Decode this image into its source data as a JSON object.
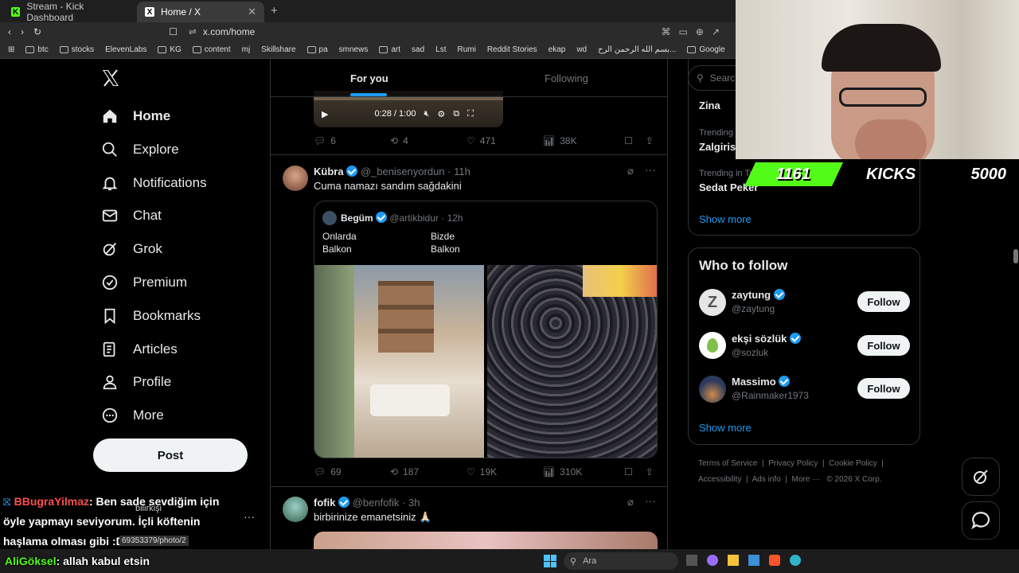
{
  "browser": {
    "tabs": [
      {
        "label": "Stream - Kick Dashboard"
      },
      {
        "label": "Home / X"
      }
    ],
    "url": "x.com/home",
    "bookmarks": [
      "btc",
      "stocks",
      "ElevenLabs",
      "KG",
      "content",
      "mj",
      "Skillshare",
      "pa",
      "smnews",
      "art",
      "sad",
      "Lst",
      "Rumi",
      "Reddit Stories",
      "ekap",
      "wd",
      "بسم الله الرحمن الرح...",
      "Google"
    ]
  },
  "nav": {
    "items": [
      {
        "label": "Home",
        "icon": "home-icon"
      },
      {
        "label": "Explore",
        "icon": "search-icon"
      },
      {
        "label": "Notifications",
        "icon": "bell-icon"
      },
      {
        "label": "Chat",
        "icon": "mail-icon"
      },
      {
        "label": "Grok",
        "icon": "grok-icon"
      },
      {
        "label": "Premium",
        "icon": "premium-icon"
      },
      {
        "label": "Bookmarks",
        "icon": "bookmark-icon"
      },
      {
        "label": "Articles",
        "icon": "articles-icon"
      },
      {
        "label": "Profile",
        "icon": "person-icon"
      },
      {
        "label": "More",
        "icon": "more-icon"
      }
    ],
    "post_label": "Post"
  },
  "feed": {
    "tabs": [
      {
        "label": "For you"
      },
      {
        "label": "Following"
      }
    ],
    "video_time": "0:28 / 1:00",
    "post0_stats": {
      "replies": "6",
      "reposts": "4",
      "likes": "471",
      "views": "38K"
    },
    "post1": {
      "name": "Kübra",
      "handle": "@_benisenyordun",
      "time": "· 11h",
      "text": "Cuma namazı sandım sağdakini",
      "quote": {
        "name": "Begüm",
        "handle": "@artikbidur",
        "time": "· 12h",
        "left_text": "Onlarda\nBalkon",
        "right_text": "Bizde\nBalkon"
      },
      "stats": {
        "replies": "69",
        "reposts": "187",
        "likes": "19K",
        "views": "310K"
      }
    },
    "post2": {
      "name": "fofik",
      "handle": "@benfofik",
      "time": "· 3h",
      "text": "birbirinize emanetsiniz 🙏🏻"
    }
  },
  "right": {
    "search_placeholder": "Searc",
    "trends": [
      {
        "context": "",
        "name": "Zina"
      },
      {
        "context": "Trending",
        "name": "Zalgiris"
      },
      {
        "context": "Trending in Tu",
        "name": "Sedat Peker"
      }
    ],
    "show_more": "Show more",
    "who_to_follow_title": "Who to follow",
    "follow_label": "Follow",
    "suggestions": [
      {
        "name": "zaytung",
        "handle": "@zaytung",
        "avatar_color": "#e6e6e6"
      },
      {
        "name": "ekşi sözlük",
        "handle": "@sozluk",
        "avatar_color": "#ffffff"
      },
      {
        "name": "Massimo",
        "handle": "@Rainmaker1973",
        "avatar_color": "#2b3a5c"
      }
    ],
    "show_more2": "Show more",
    "footer": [
      "Terms of Service",
      "Privacy Policy",
      "Cookie Policy",
      "Accessibility",
      "Ads info",
      "More ···",
      "© 2026 X Corp."
    ]
  },
  "overlay": {
    "kick_count": "1161",
    "kick_label": "KICKS",
    "kick_goal": "5000",
    "chat1_user": "BBugraYilmaz",
    "chat1_text": ": Ben sade sevdiğim için öyle yapmayı seviyorum. İçli köftenin haşlama olması gibi :D",
    "chat2_user": "AliGöksel",
    "chat2_text": ": allah kabul etsin",
    "status_url": "69353379/photo/2",
    "hidden_name": "bilirkişi"
  },
  "taskbar": {
    "search_placeholder": "Ara"
  },
  "colors": {
    "accent": "#1d9bf0",
    "kick_green": "#53fc18",
    "bg": "#000000"
  }
}
